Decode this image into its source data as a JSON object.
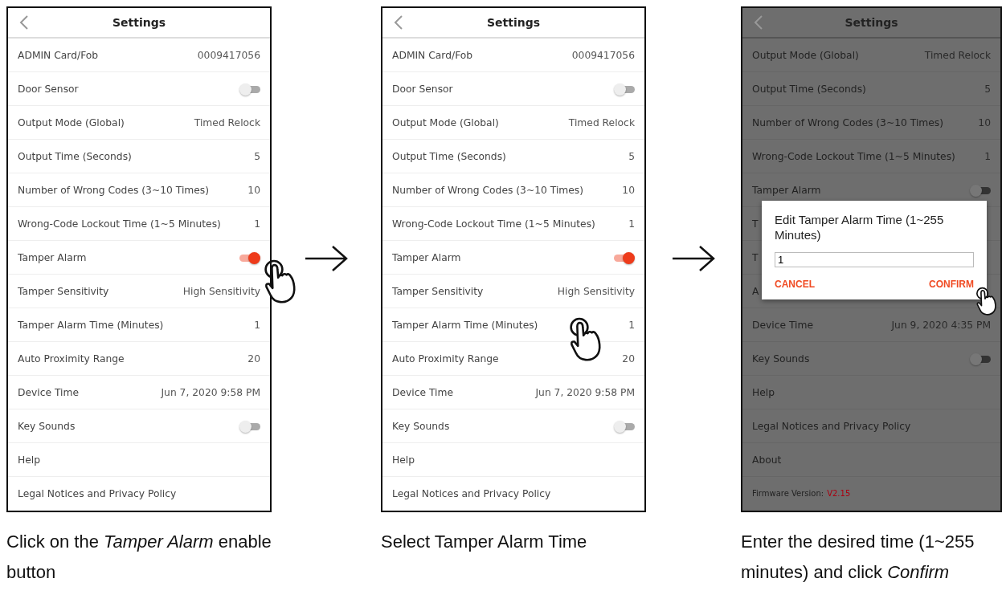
{
  "panels": [
    {
      "screen": {
        "title": "Settings",
        "rows": [
          {
            "kind": "value",
            "label": "ADMIN Card/Fob",
            "value": "0009417056"
          },
          {
            "kind": "toggle",
            "label": "Door Sensor",
            "checked": false
          },
          {
            "kind": "value",
            "label": "Output Mode (Global)",
            "value": "Timed Relock"
          },
          {
            "kind": "value",
            "label": "Output Time (Seconds)",
            "value": "5"
          },
          {
            "kind": "value",
            "label": "Number of Wrong Codes (3~10 Times)",
            "value": "10"
          },
          {
            "kind": "value",
            "label": "Wrong-Code Lockout Time (1~5 Minutes)",
            "value": "1"
          },
          {
            "kind": "toggle",
            "label": "Tamper Alarm",
            "checked": true
          },
          {
            "kind": "value",
            "label": "Tamper Sensitivity",
            "value": "High Sensitivity"
          },
          {
            "kind": "value",
            "label": "Tamper Alarm Time (Minutes)",
            "value": "1"
          },
          {
            "kind": "value",
            "label": "Auto Proximity Range",
            "value": "20"
          },
          {
            "kind": "value",
            "label": "Device Time",
            "value": "Jun 7, 2020 9:58 PM"
          },
          {
            "kind": "toggle",
            "label": "Key Sounds",
            "checked": false
          },
          {
            "kind": "link",
            "label": "Help"
          },
          {
            "kind": "link",
            "label": "Legal Notices and Privacy Policy"
          }
        ]
      },
      "caption": "Click on the *Tamper Alarm* enable button"
    },
    {
      "screen": {
        "title": "Settings",
        "rows": [
          {
            "kind": "value",
            "label": "ADMIN Card/Fob",
            "value": "0009417056"
          },
          {
            "kind": "toggle",
            "label": "Door Sensor",
            "checked": false
          },
          {
            "kind": "value",
            "label": "Output Mode (Global)",
            "value": "Timed Relock"
          },
          {
            "kind": "value",
            "label": "Output Time (Seconds)",
            "value": "5"
          },
          {
            "kind": "value",
            "label": "Number of Wrong Codes (3~10 Times)",
            "value": "10"
          },
          {
            "kind": "value",
            "label": "Wrong-Code Lockout Time (1~5 Minutes)",
            "value": "1"
          },
          {
            "kind": "toggle",
            "label": "Tamper Alarm",
            "checked": true
          },
          {
            "kind": "value",
            "label": "Tamper Sensitivity",
            "value": "High Sensitivity"
          },
          {
            "kind": "value",
            "label": "Tamper Alarm Time (Minutes)",
            "value": "1"
          },
          {
            "kind": "value",
            "label": "Auto Proximity Range",
            "value": "20"
          },
          {
            "kind": "value",
            "label": "Device Time",
            "value": "Jun 7, 2020 9:58 PM"
          },
          {
            "kind": "toggle",
            "label": "Key Sounds",
            "checked": false
          },
          {
            "kind": "link",
            "label": "Help"
          },
          {
            "kind": "link",
            "label": "Legal Notices and Privacy Policy"
          }
        ]
      },
      "caption": "Select Tamper Alarm Time"
    },
    {
      "screen": {
        "title": "Settings",
        "rows": [
          {
            "kind": "value",
            "label": "Output Mode (Global)",
            "value": "Timed Relock"
          },
          {
            "kind": "value",
            "label": "Output Time (Seconds)",
            "value": "5"
          },
          {
            "kind": "value",
            "label": "Number of Wrong Codes (3~10 Times)",
            "value": "10"
          },
          {
            "kind": "value",
            "label": "Wrong-Code Lockout Time (1~5 Minutes)",
            "value": "1"
          },
          {
            "kind": "toggle",
            "label": "Tamper Alarm",
            "checked": false
          },
          {
            "kind": "link",
            "label": "T"
          },
          {
            "kind": "link",
            "label": "T"
          },
          {
            "kind": "link",
            "label": "A"
          },
          {
            "kind": "value",
            "label": "Device Time",
            "value": "Jun 9, 2020 4:35 PM"
          },
          {
            "kind": "toggle",
            "label": "Key Sounds",
            "checked": false
          },
          {
            "kind": "link",
            "label": "Help"
          },
          {
            "kind": "link",
            "label": "Legal Notices and Privacy Policy"
          },
          {
            "kind": "link",
            "label": "About"
          },
          {
            "kind": "firmware",
            "label": "Firmware Version:",
            "value": "V2.15"
          }
        ],
        "dialog": {
          "title": "Edit Tamper Alarm Time (1~255 Minutes)",
          "value": "1",
          "buttons": [
            "CANCEL",
            "CONFIRM"
          ]
        }
      },
      "caption": "Enter the desired time (1~255 minutes) and click *Confirm*"
    }
  ]
}
